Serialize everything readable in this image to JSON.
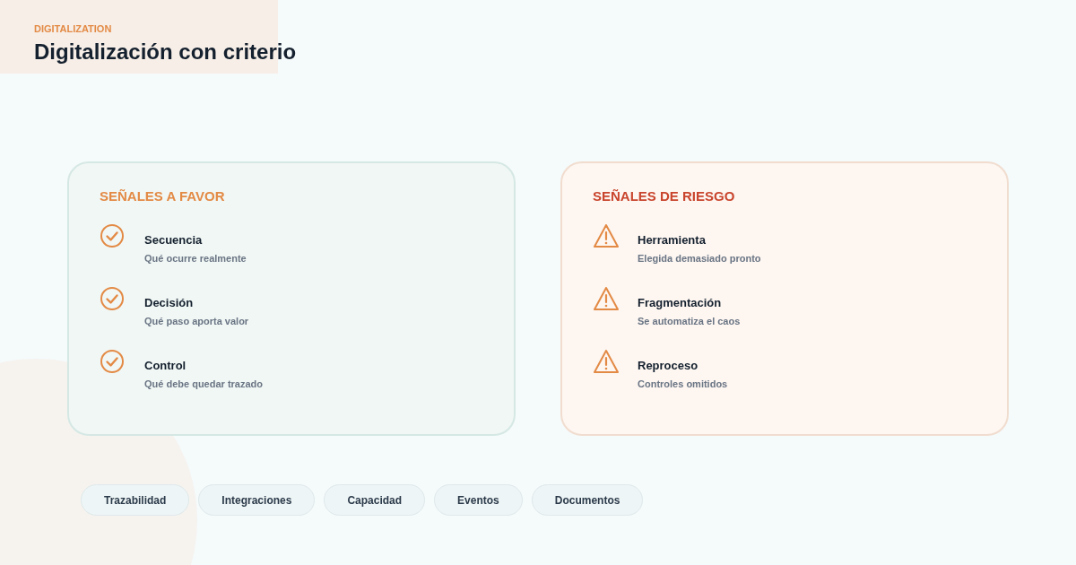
{
  "header": {
    "eyebrow": "DIGITALIZATION",
    "title": "Digitalización con criterio"
  },
  "panels": [
    {
      "kind": "favor",
      "heading": "SEÑALES A FAVOR",
      "items": [
        {
          "title": "Secuencia",
          "subtitle": "Qué ocurre realmente"
        },
        {
          "title": "Decisión",
          "subtitle": "Qué paso aporta valor"
        },
        {
          "title": "Control",
          "subtitle": "Qué debe quedar trazado"
        }
      ]
    },
    {
      "kind": "risk",
      "heading": "SEÑALES DE RIESGO",
      "items": [
        {
          "title": "Herramienta",
          "subtitle": "Elegida demasiado pronto"
        },
        {
          "title": "Fragmentación",
          "subtitle": "Se automatiza el caos"
        },
        {
          "title": "Reproceso",
          "subtitle": "Controles omitidos"
        }
      ]
    }
  ],
  "tags": [
    "Trazabilidad",
    "Integraciones",
    "Capacidad",
    "Eventos",
    "Documentos"
  ]
}
